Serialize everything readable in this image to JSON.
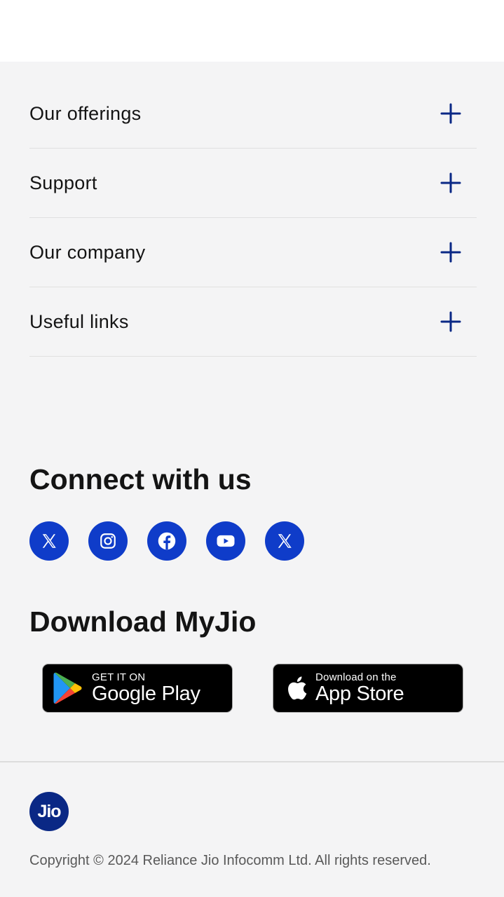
{
  "footer": {
    "accordion": [
      {
        "label": "Our offerings"
      },
      {
        "label": "Support"
      },
      {
        "label": "Our company"
      },
      {
        "label": "Useful links"
      }
    ],
    "connect": {
      "title": "Connect with us",
      "social": [
        {
          "icon": "x-icon"
        },
        {
          "icon": "instagram-icon"
        },
        {
          "icon": "facebook-icon"
        },
        {
          "icon": "youtube-icon"
        },
        {
          "icon": "x-icon"
        }
      ]
    },
    "download": {
      "title": "Download MyJio",
      "google_play": {
        "small": "GET IT ON",
        "big": "Google Play"
      },
      "app_store": {
        "small": "Download on the",
        "big": "App Store"
      }
    },
    "logo_text": "Jio",
    "copyright": "Copyright © 2024 Reliance Jio Infocomm Ltd. All rights reserved."
  },
  "colors": {
    "accent": "#0f3cc9",
    "plus_icon": "#0a2885",
    "logo_bg": "#0a2885",
    "footer_bg": "#f4f4f5"
  }
}
